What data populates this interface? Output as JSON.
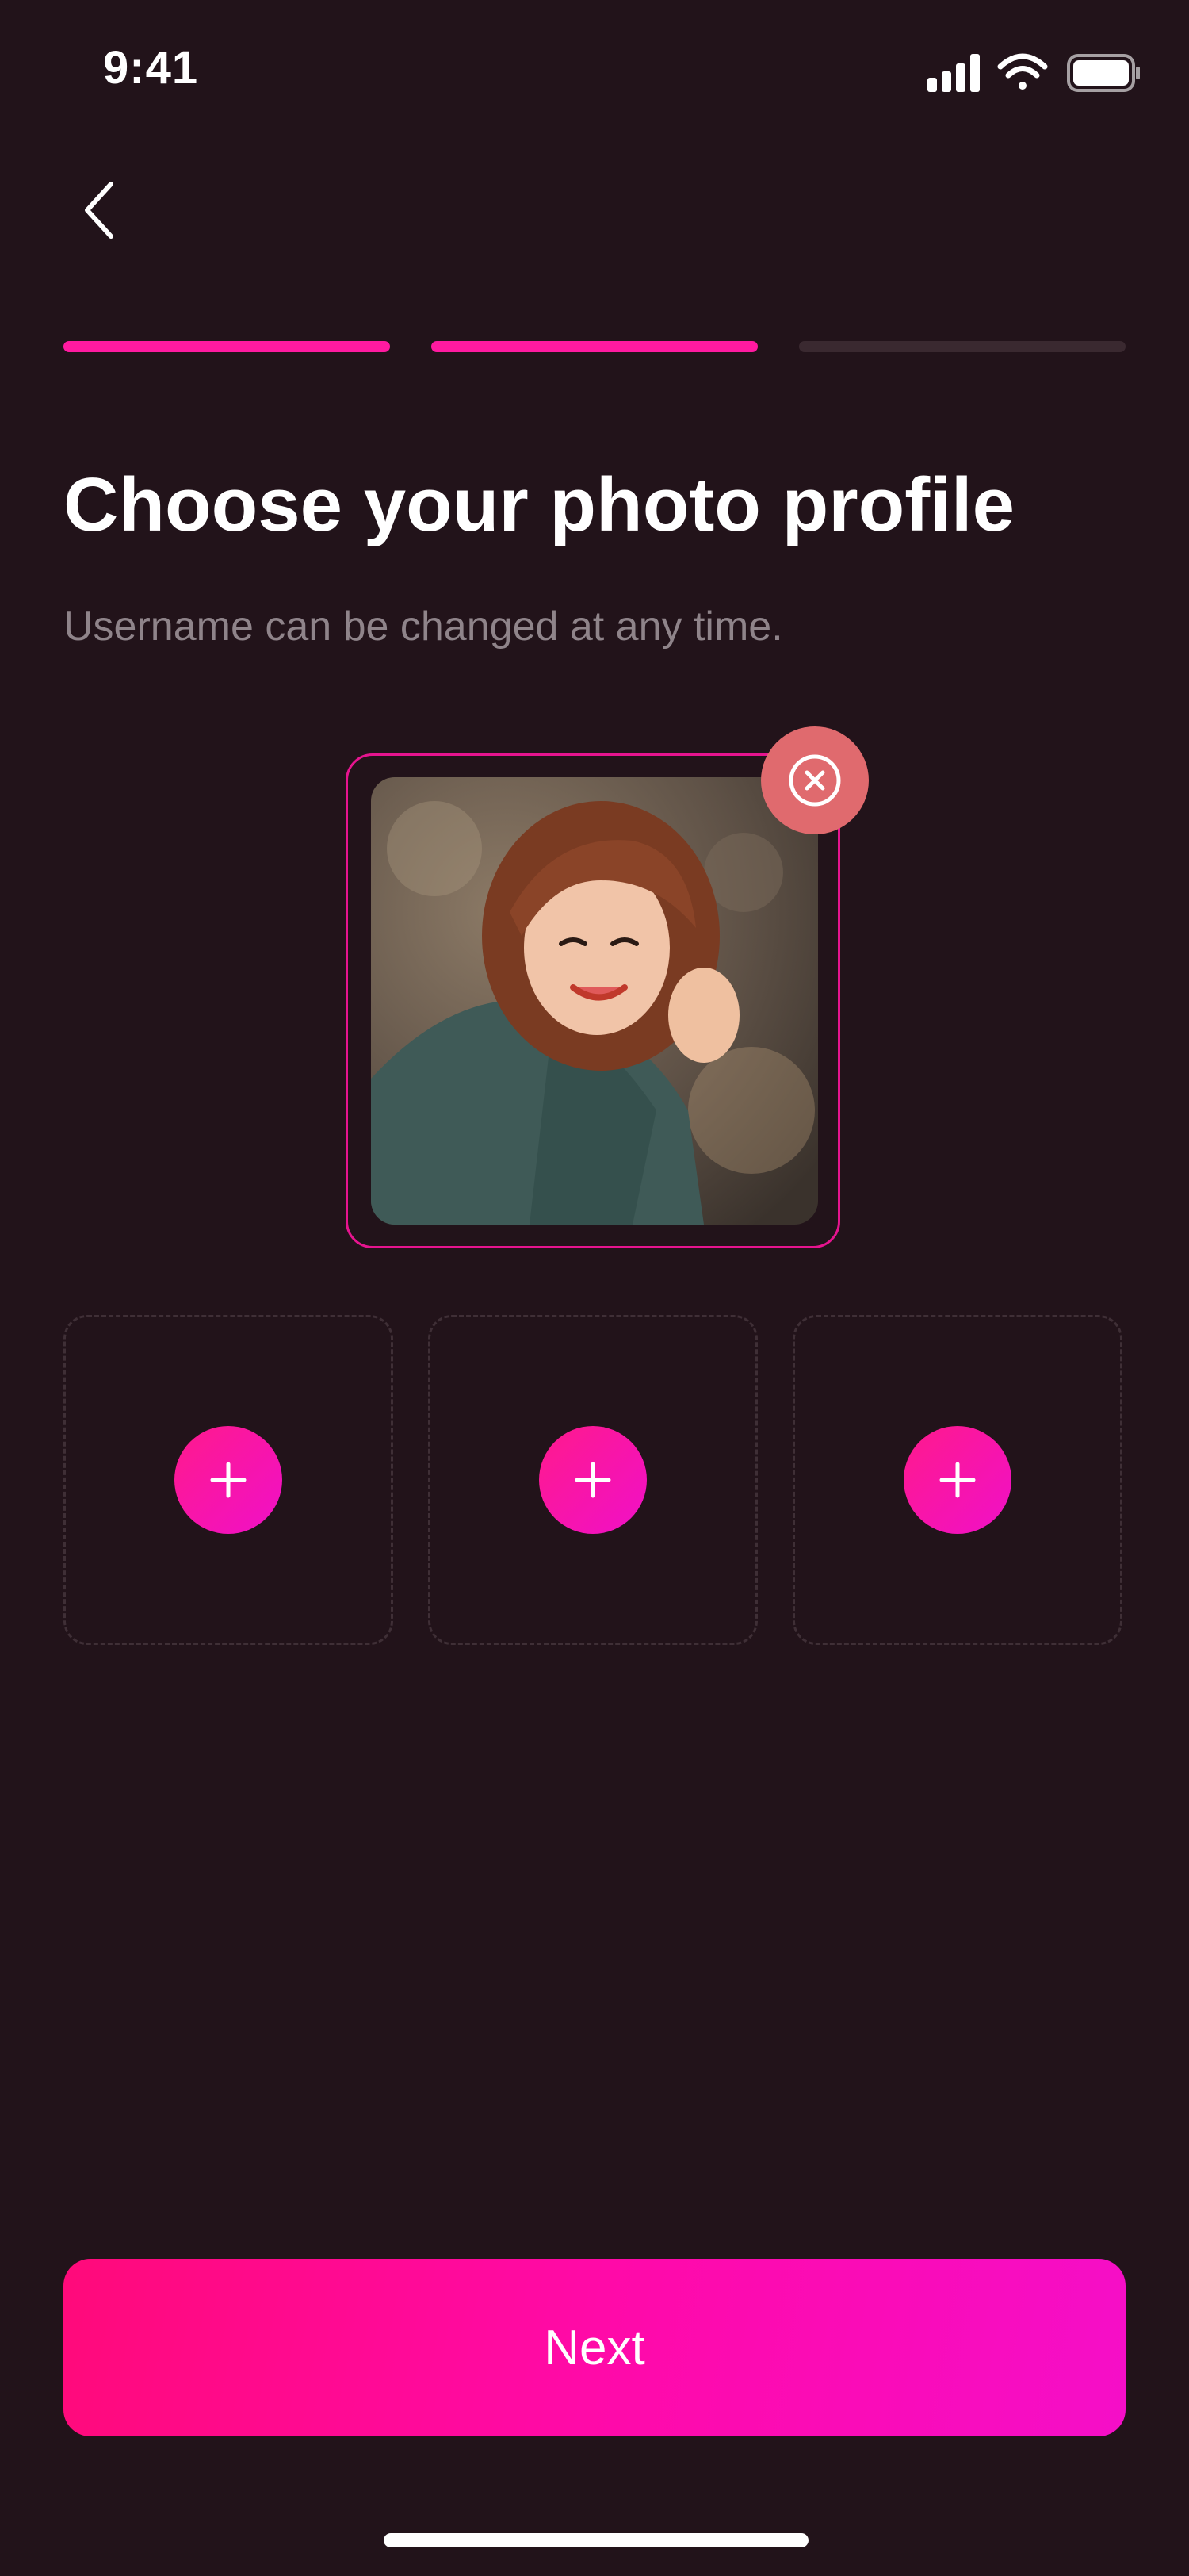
{
  "status_bar": {
    "time": "9:41"
  },
  "progress": {
    "steps_total": 3,
    "steps_completed": 2
  },
  "header": {
    "title": "Choose your photo profile",
    "subtitle": "Username can be changed at any time."
  },
  "photos": {
    "selected_count": 1,
    "empty_slots": 3
  },
  "actions": {
    "next_label": "Next"
  },
  "colors": {
    "background": "#22131a",
    "accent": "#ff1aa0",
    "remove": "#e06a6e",
    "muted_text": "#8f848a"
  },
  "icons": {
    "back": "chevron-left-icon",
    "remove": "close-circle-icon",
    "add": "plus-icon",
    "signal": "signal-icon",
    "wifi": "wifi-icon",
    "battery": "battery-icon"
  }
}
